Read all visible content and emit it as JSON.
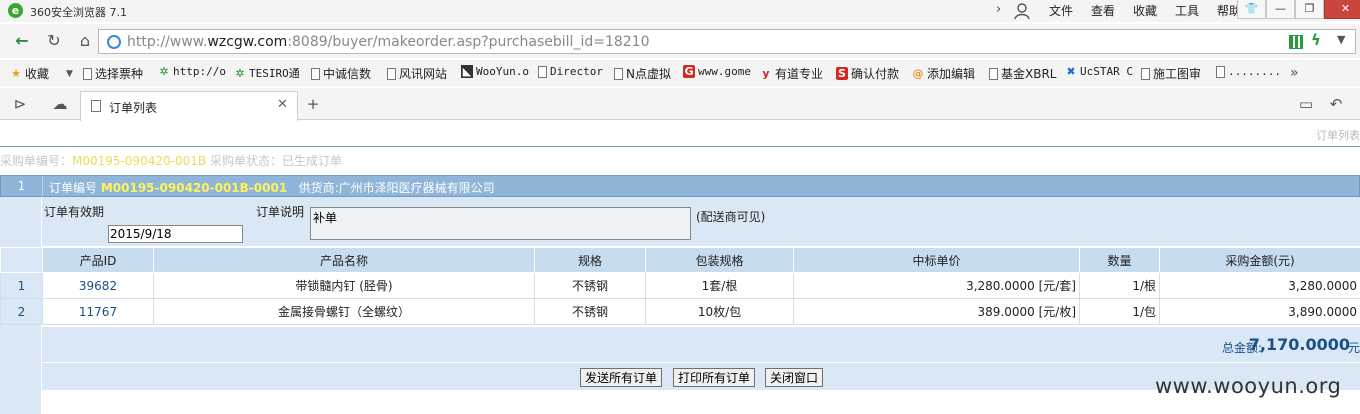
{
  "window": {
    "title": "360安全浏览器 7.1",
    "menu": [
      "文件",
      "查看",
      "收藏",
      "工具",
      "帮助"
    ]
  },
  "address": {
    "url_prefix": "http://www.",
    "url_host": "wzcgw.com",
    "url_rest": ":8089/buyer/makeorder.asp?purchasebill_id=18210"
  },
  "favorites": [
    {
      "label": "收藏",
      "icon": "star-icon"
    },
    {
      "label": "选择票种",
      "icon": "page-icon"
    },
    {
      "label": "http://o",
      "icon": "gear-icon"
    },
    {
      "label": "TESIRO通",
      "icon": "gear-icon"
    },
    {
      "label": "中诚信数",
      "icon": "page-icon"
    },
    {
      "label": "风讯网站",
      "icon": "page-icon"
    },
    {
      "label": "WooYun.o",
      "icon": "wooyun-icon"
    },
    {
      "label": "Director",
      "icon": "page-icon"
    },
    {
      "label": "N点虚拟",
      "icon": "page-icon"
    },
    {
      "label": "www.gome",
      "icon": "gome-icon"
    },
    {
      "label": "有道专业",
      "icon": "youdao-icon"
    },
    {
      "label": "确认付款",
      "icon": "s-icon"
    },
    {
      "label": "添加编辑",
      "icon": "swirl-icon"
    },
    {
      "label": "基金XBRL",
      "icon": "page-icon"
    },
    {
      "label": "UcSTAR C",
      "icon": "ucstar-icon"
    },
    {
      "label": "施工图审",
      "icon": "page-icon"
    },
    {
      "label": "........",
      "icon": "page-icon"
    }
  ],
  "tab": {
    "label": "订单列表"
  },
  "page": {
    "crumb": "订单列表",
    "status_prefix": "采购单编号：",
    "status_code": "M00195-090420-001B",
    "status_suffix": "  采购单状态：已生成订单"
  },
  "order": {
    "index": "1",
    "code_label": "订单编号",
    "code": "M00195-090420-001B-0001",
    "supplier_label": "供货商:",
    "supplier": "广州市泽阳医疗器械有限公司",
    "expiry_label": "订单有效期",
    "expiry_value": "2015/9/18",
    "note_label": "订单说明",
    "note_value": "补单",
    "note_visibility": "(配送商可见)"
  },
  "table": {
    "headers": [
      "产品ID",
      "产品名称",
      "规格",
      "包装规格",
      "中标单价",
      "数量",
      "采购金额(元)"
    ],
    "rows": [
      {
        "idx": "1",
        "pid": "39682",
        "name": "带锁髓内钉 (胫骨)",
        "spec": "不锈钢",
        "pack": "1套/根",
        "price": "3,280.0000 [元/套]",
        "qty": "1/根",
        "amount": "3,280.0000"
      },
      {
        "idx": "2",
        "pid": "11767",
        "name": "金属接骨螺钉（全螺纹）",
        "spec": "不锈钢",
        "pack": "10枚/包",
        "price": "389.0000 [元/枚]",
        "qty": "1/包",
        "amount": "3,890.0000"
      }
    ]
  },
  "total": {
    "label": "总金额:",
    "value": "7,170.0000",
    "unit": "元"
  },
  "buttons": {
    "send": "发送所有订单",
    "print": "打印所有订单",
    "close": "关闭窗口"
  },
  "watermark": "www.wooyun.org"
}
